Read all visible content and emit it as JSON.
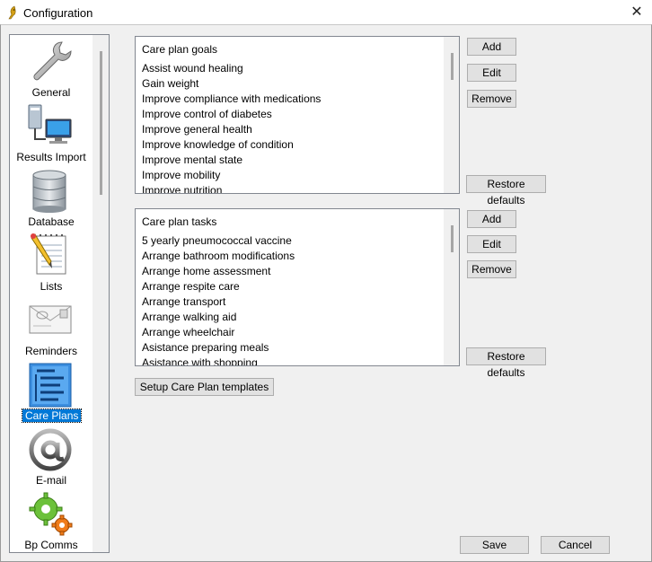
{
  "window": {
    "title": "Configuration",
    "close_glyph": "✕"
  },
  "sidebar": {
    "items": [
      {
        "label": "General",
        "icon": "wrench-icon"
      },
      {
        "label": "Results Import",
        "icon": "computer-network-icon"
      },
      {
        "label": "Database",
        "icon": "database-icon"
      },
      {
        "label": "Lists",
        "icon": "notepad-pencil-icon"
      },
      {
        "label": "Reminders",
        "icon": "envelope-icon"
      },
      {
        "label": "Care Plans",
        "icon": "care-plan-icon",
        "selected": true
      },
      {
        "label": "E-mail",
        "icon": "at-sign-icon"
      },
      {
        "label": "Bp Comms",
        "icon": "gears-icon"
      }
    ]
  },
  "goals": {
    "header": "Care plan goals",
    "items": [
      "Assist wound healing",
      "Gain weight",
      "Improve compliance with medications",
      "Improve control of diabetes",
      "Improve general health",
      "Improve knowledge of condition",
      "Improve mental state",
      "Improve mobility",
      "Improve nutrition"
    ],
    "add_label": "Add",
    "edit_label": "Edit",
    "remove_label": "Remove",
    "restore_label": "Restore defaults"
  },
  "tasks": {
    "header": "Care plan tasks",
    "items": [
      "5 yearly pneumococcal vaccine",
      "Arrange bathroom modifications",
      "Arrange home assessment",
      "Arrange respite care",
      "Arrange transport",
      "Arrange walking aid",
      "Arrange wheelchair",
      "Asistance preparing meals",
      "Asistance with shopping"
    ],
    "add_label": "Add",
    "edit_label": "Edit",
    "remove_label": "Remove",
    "restore_label": "Restore defaults"
  },
  "templates_button": "Setup Care Plan templates",
  "footer": {
    "save_label": "Save",
    "cancel_label": "Cancel"
  },
  "colors": {
    "selection": "#0078d7",
    "button_face": "#e1e1e1",
    "window_bg": "#f0f0f0"
  }
}
